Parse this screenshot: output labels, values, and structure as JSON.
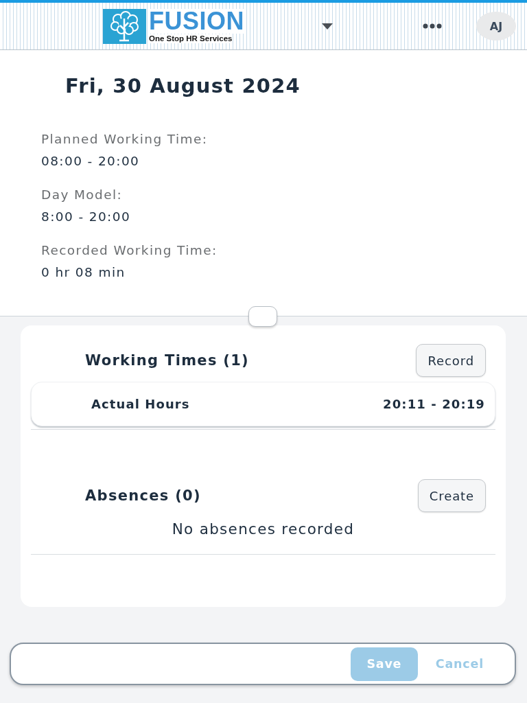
{
  "header": {
    "logo": {
      "title": "FUSION",
      "tagline": "One Stop HR Services"
    },
    "avatar": "AJ"
  },
  "day": {
    "title": "Fri, 30 August 2024",
    "details": [
      {
        "label": "Planned Working Time:",
        "value": "08:00 - 20:00"
      },
      {
        "label": "Day Model:",
        "value": "8:00 - 20:00"
      },
      {
        "label": "Recorded Working Time:",
        "value": "0 hr 08 min"
      }
    ]
  },
  "sections": [
    {
      "kind": "list",
      "title": "Working Times (1)",
      "action": "Record",
      "entries": [
        {
          "label": "Actual Hours",
          "time": "20:11 - 20:19"
        }
      ]
    },
    {
      "kind": "empty",
      "title": "Absences (0)",
      "action": "Create",
      "empty_text": "No absences recorded"
    }
  ],
  "footer": {
    "buttons": [
      {
        "kind": "primary",
        "label": "Save",
        "disabled": true
      },
      {
        "kind": "link",
        "label": "Cancel",
        "disabled": true
      }
    ]
  }
}
